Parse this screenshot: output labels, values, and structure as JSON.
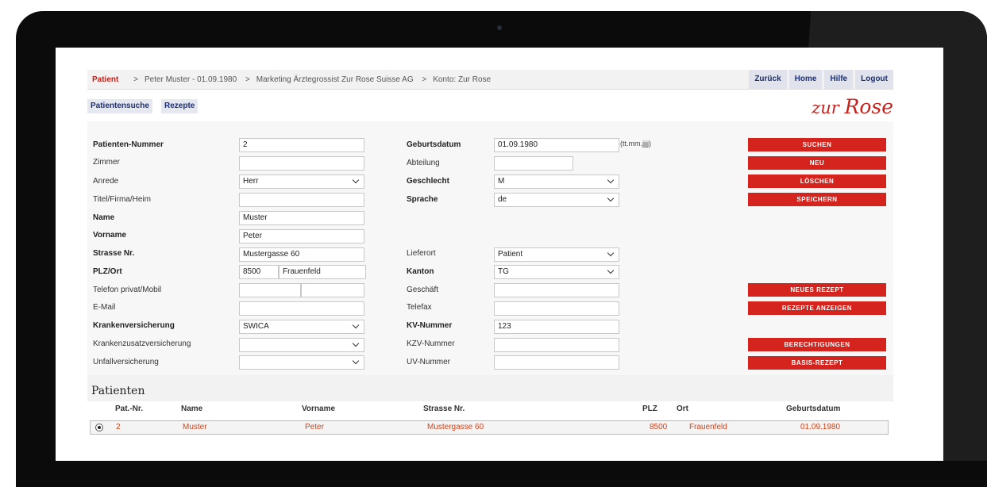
{
  "breadcrumb": {
    "patient": "Patient",
    "items": [
      "Peter Muster - 01.09.1980",
      "Marketing Ärztegrossist Zur Rose Suisse AG",
      "Konto: Zur Rose"
    ]
  },
  "topnav": [
    "Zurück",
    "Home",
    "Hilfe",
    "Logout"
  ],
  "subtabs": [
    "Patientensuche",
    "Rezepte"
  ],
  "logo": {
    "first": "zur",
    "second": "Rose"
  },
  "form": {
    "patienten_nummer": {
      "label": "Patienten-Nummer",
      "value": "2"
    },
    "zimmer": {
      "label": "Zimmer",
      "value": ""
    },
    "anrede": {
      "label": "Anrede",
      "value": "Herr"
    },
    "titel": {
      "label": "Titel/Firma/Heim",
      "value": ""
    },
    "name": {
      "label": "Name",
      "value": "Muster"
    },
    "vorname": {
      "label": "Vorname",
      "value": "Peter"
    },
    "strasse": {
      "label": "Strasse Nr.",
      "value": "Mustergasse 60"
    },
    "plz_ort": {
      "label": "PLZ/Ort",
      "plz": "8500",
      "ort": "Frauenfeld"
    },
    "telefon": {
      "label": "Telefon privat/Mobil",
      "privat": "",
      "mobil": ""
    },
    "email": {
      "label": "E-Mail",
      "value": ""
    },
    "krankenversicherung": {
      "label": "Krankenversicherung",
      "value": "SWICA"
    },
    "zusatzversicherung": {
      "label": "Krankenzusatzversicherung",
      "value": ""
    },
    "unfallversicherung": {
      "label": "Unfallversicherung",
      "value": ""
    },
    "geburtsdatum": {
      "label": "Geburtsdatum",
      "value": "01.09.1980",
      "hint": "(tt.mm.jjjj)"
    },
    "abteilung": {
      "label": "Abteilung",
      "value": ""
    },
    "geschlecht": {
      "label": "Geschlecht",
      "value": "M"
    },
    "sprache": {
      "label": "Sprache",
      "value": "de"
    },
    "lieferort": {
      "label": "Lieferort",
      "value": "Patient"
    },
    "kanton": {
      "label": "Kanton",
      "value": "TG"
    },
    "geschaeft": {
      "label": "Geschäft",
      "value": ""
    },
    "telefax": {
      "label": "Telefax",
      "value": ""
    },
    "kv_nummer": {
      "label": "KV-Nummer",
      "value": "123"
    },
    "kzv_nummer": {
      "label": "KZV-Nummer",
      "value": ""
    },
    "uv_nummer": {
      "label": "UV-Nummer",
      "value": ""
    }
  },
  "buttons": {
    "suchen": "SUCHEN",
    "neu": "NEU",
    "loeschen": "LÖSCHEN",
    "speichern": "SPEICHERN",
    "neues_rezept": "NEUES REZEPT",
    "rezepte_anzeigen": "REZEPTE ANZEIGEN",
    "berechtigungen": "BERECHTIGUNGEN",
    "basis_rezept": "BASIS-REZEPT"
  },
  "results": {
    "title": "Patienten",
    "columns": [
      "Pat.-Nr.",
      "Name",
      "Vorname",
      "Strasse Nr.",
      "PLZ",
      "Ort",
      "Geburtsdatum"
    ],
    "rows": [
      {
        "nr": "2",
        "name": "Muster",
        "vorname": "Peter",
        "strasse": "Mustergasse 60",
        "plz": "8500",
        "ort": "Frauenfeld",
        "geburtsdatum": "01.09.1980"
      }
    ]
  },
  "colors": {
    "accent": "#d5231d",
    "nav": "#1b2f7a",
    "row_text": "#d0441c"
  }
}
